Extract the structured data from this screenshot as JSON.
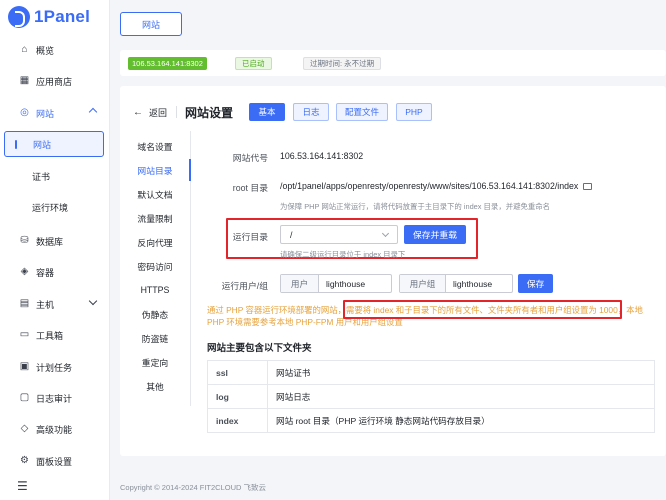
{
  "brand": {
    "name": "1Panel"
  },
  "sidebar": {
    "items": [
      {
        "label": "概览",
        "icon": "home-icon"
      },
      {
        "label": "应用商店",
        "icon": "apps-icon"
      },
      {
        "label": "网站",
        "icon": "globe-icon"
      },
      {
        "label": "数据库",
        "icon": "database-icon"
      },
      {
        "label": "容器",
        "icon": "container-icon"
      },
      {
        "label": "主机",
        "icon": "host-icon"
      },
      {
        "label": "工具箱",
        "icon": "toolbox-icon"
      },
      {
        "label": "计划任务",
        "icon": "calendar-icon"
      },
      {
        "label": "日志审计",
        "icon": "log-icon"
      },
      {
        "label": "高级功能",
        "icon": "diamond-icon"
      },
      {
        "label": "面板设置",
        "icon": "settings-icon"
      }
    ],
    "website_sub": [
      {
        "label": "网站"
      },
      {
        "label": "证书"
      },
      {
        "label": "运行环境"
      }
    ]
  },
  "top_tab": {
    "label": "网站"
  },
  "status": {
    "address": "106.53.164.141:8302",
    "state": "已启动",
    "expire": "过期时间: 永不过期"
  },
  "header": {
    "back": "返回",
    "title": "网站设置",
    "buttons": [
      "基本",
      "日志",
      "配置文件",
      "PHP"
    ]
  },
  "left_menu": [
    "域名设置",
    "网站目录",
    "默认文档",
    "流量限制",
    "反向代理",
    "密码访问",
    "HTTPS",
    "伪静态",
    "防盗链",
    "重定向",
    "其他"
  ],
  "form": {
    "code_label": "网站代号",
    "code_value": "106.53.164.141:8302",
    "root_label": "root 目录",
    "root_value": "/opt/1panel/apps/openresty/openresty/www/sites/106.53.164.141:8302/index",
    "root_hint": "为保障 PHP 网站正常运行，请将代码放置于主目录下的 index 目录，并避免重命名",
    "run_label": "运行目录",
    "run_value": "/",
    "run_hint": "请确保二级运行目录位于 index 目录下",
    "save_reload": "保存并重载",
    "user_label": "运行用户/组",
    "user_prefix": "用户",
    "user_value": "lighthouse",
    "group_prefix": "用户组",
    "group_value": "lighthouse",
    "save": "保存"
  },
  "warning": {
    "before": "通过 PHP 容器运行环境部署的网站，",
    "highlight": "需要将 index 和子目录下的所有文件、文件夹所有者和用户组设置为 1000",
    "after": "，本地 PHP 环境需要参考本地 PHP-FPM 用户和用户组设置"
  },
  "section_title": "网站主要包含以下文件夹",
  "folders": [
    {
      "key": "ssl",
      "desc": "网站证书"
    },
    {
      "key": "log",
      "desc": "网站日志"
    },
    {
      "key": "index",
      "desc": "网站 root 目录（PHP 运行环境 静态网站代码存放目录）"
    }
  ],
  "footer": "Copyright © 2014-2024 FIT2CLOUD 飞致云"
}
